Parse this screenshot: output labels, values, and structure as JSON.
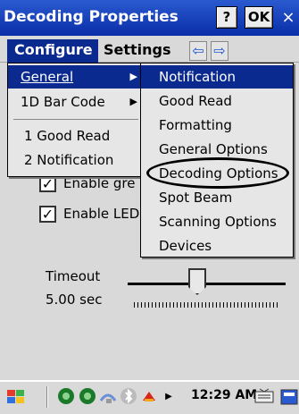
{
  "window": {
    "title": "Decoding Properties",
    "help_label": "?",
    "ok_label": "OK",
    "close_label": "×"
  },
  "menubar": {
    "configure_label": "Configure",
    "settings_label": "Settings",
    "left_arrow": "⇦",
    "right_arrow": "⇨"
  },
  "configure_menu": {
    "items": [
      {
        "label": "General",
        "has_submenu": true,
        "highlighted": true
      },
      {
        "label": "1D Bar Code",
        "has_submenu": true,
        "highlighted": false
      },
      {
        "label": "1 Good Read",
        "has_submenu": false,
        "highlighted": false
      },
      {
        "label": "2 Notification",
        "has_submenu": false,
        "highlighted": false
      }
    ]
  },
  "general_submenu": {
    "items": [
      {
        "label": "Notification",
        "highlighted": true
      },
      {
        "label": "Good Read",
        "highlighted": false
      },
      {
        "label": "Formatting",
        "highlighted": false
      },
      {
        "label": "General Options",
        "highlighted": false
      },
      {
        "label": "Decoding Options",
        "highlighted": false,
        "circled": true
      },
      {
        "label": "Spot Beam",
        "highlighted": false
      },
      {
        "label": "Scanning Options",
        "highlighted": false
      },
      {
        "label": "Devices",
        "highlighted": false
      }
    ]
  },
  "content": {
    "check1_label": "Enable gre",
    "check1_checked": true,
    "check2_label": "Enable LED",
    "check2_checked": true,
    "timeout_label": "Timeout",
    "timeout_value": "5.00 sec"
  },
  "taskbar": {
    "clock": "12:29 AM",
    "icons": [
      "start-flag-icon",
      "network-icon",
      "network2-icon",
      "wifi-icon",
      "bluetooth-icon",
      "battery-icon",
      "desktop-icon",
      "keyboard-icon"
    ]
  },
  "colors": {
    "titlebar": "#0a2ea8",
    "highlight": "#0b2a8f",
    "background": "#d9d9d9"
  }
}
